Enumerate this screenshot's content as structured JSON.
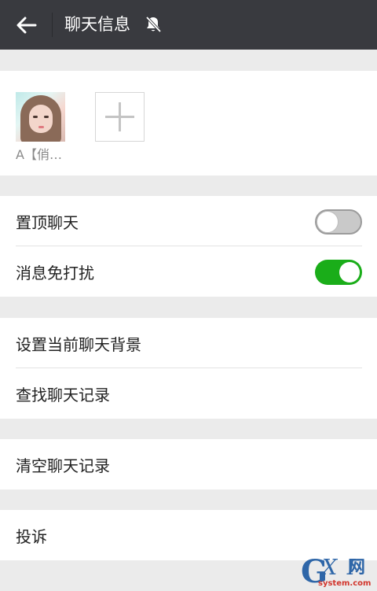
{
  "header": {
    "title": "聊天信息",
    "back_icon": "arrow-left-icon",
    "mute_icon": "bell-muted-icon"
  },
  "members": {
    "items": [
      {
        "name": "A【俏…"
      }
    ],
    "add_icon": "plus-icon"
  },
  "settings": {
    "pin_chat": {
      "label": "置顶聊天",
      "on": false
    },
    "do_not_disturb": {
      "label": "消息免打扰",
      "on": true
    },
    "set_background": {
      "label": "设置当前聊天背景"
    },
    "search_history": {
      "label": "查找聊天记录"
    },
    "clear_history": {
      "label": "清空聊天记录"
    },
    "report": {
      "label": "投诉"
    }
  },
  "watermark": {
    "brand": "G X I 网",
    "site": "system.com"
  },
  "colors": {
    "header_bg": "#393a3f",
    "toggle_on": "#1aad19",
    "page_bg": "#ebebeb"
  }
}
